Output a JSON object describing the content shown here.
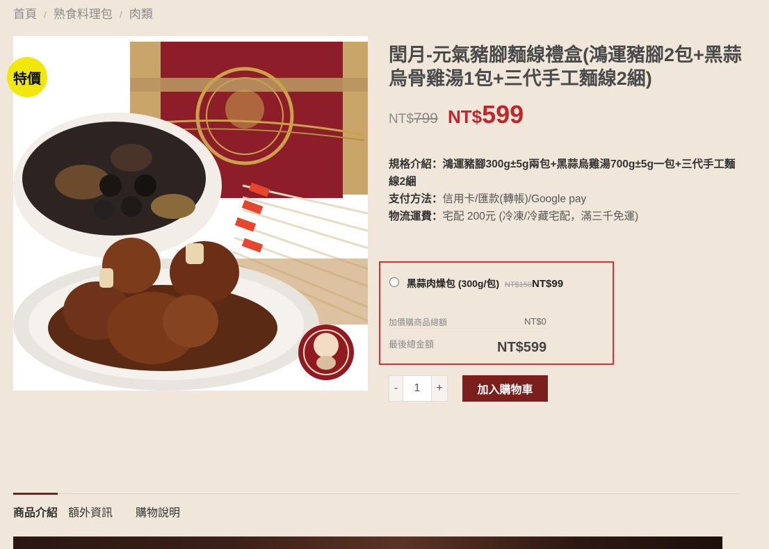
{
  "breadcrumb": {
    "home": "首頁",
    "category": "熟食料理包",
    "current": "肉類",
    "separator": "/"
  },
  "product": {
    "sale_badge": "特價",
    "title": "閏月-元氣豬腳麵線禮盒(鴻運豬腳2包+黑蒜烏骨雞湯1包+三代手工麵線2綑)",
    "old_price_currency": "NT$",
    "old_price_value": "799",
    "new_price_currency": "NT$",
    "new_price_value": "599"
  },
  "specs": {
    "spec_label": "規格介紹：",
    "spec_value": "鴻運豬腳300g±5g兩包+黑蒜烏雞湯700g±5g一包+三代手工麵線2綑",
    "payment_label": "支付方法：",
    "payment_value": "信用卡/匯款(轉帳)/Google pay",
    "shipping_label": "物流運費：",
    "shipping_value": "宅配 200元 (冷凍/冷藏宅配，滿三千免運)"
  },
  "addon": {
    "name": "黑蒜肉燥包 (300g/包)",
    "old_price": "NT$150",
    "new_price": "NT$99",
    "addon_total_label": "加價購商品總額",
    "addon_total_value": "NT$0",
    "final_total_label": "最後總金額",
    "final_total_value": "NT$599"
  },
  "cart": {
    "minus_label": "-",
    "plus_label": "+",
    "quantity": "1",
    "add_to_cart_label": "加入購物車"
  },
  "tabs": [
    {
      "label": "商品介紹",
      "active": true
    },
    {
      "label": "額外資訊",
      "active": false
    },
    {
      "label": "購物說明",
      "active": false
    }
  ],
  "colors": {
    "accent": "#7a1f1c",
    "sale_price": "#c0272d",
    "badge": "#f0e80a",
    "addon_border": "#e02d2d",
    "background": "#f0e7da"
  },
  "icons": {
    "zoom": "expand-icon"
  }
}
